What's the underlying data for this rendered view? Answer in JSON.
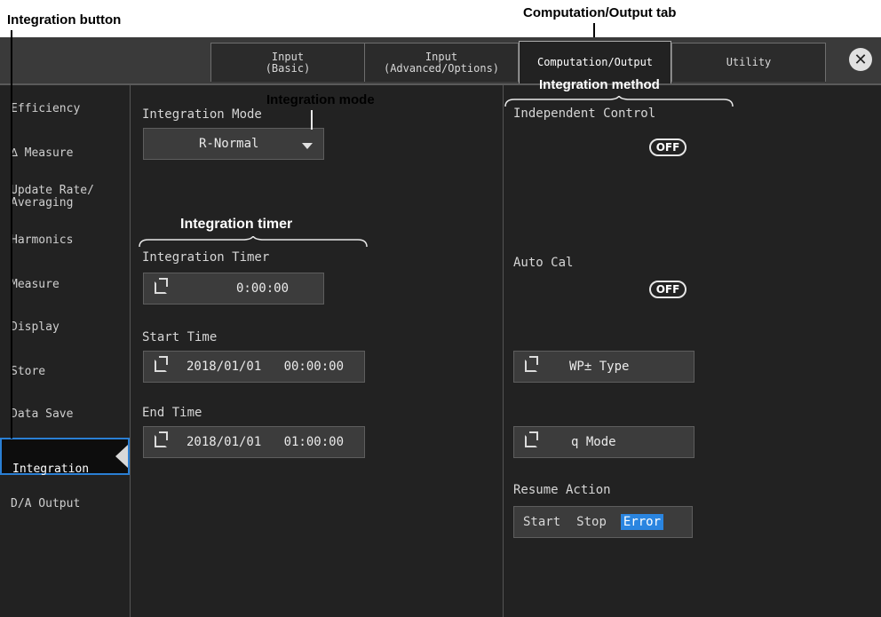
{
  "callouts": {
    "integration_button": "Integration button",
    "comp_output_tab": "Computation/Output tab",
    "integration_mode": "Integration mode",
    "integration_method": "Integration method",
    "integration_timer": "Integration timer"
  },
  "tabs": [
    {
      "label": "Input\n(Basic)"
    },
    {
      "label": "Input\n(Advanced/Options)"
    },
    {
      "label": "Computation/Output"
    },
    {
      "label": "Utility"
    }
  ],
  "close_glyph": "✕",
  "sidebar": {
    "items": [
      {
        "label": "Efficiency"
      },
      {
        "label": "∆ Measure"
      },
      {
        "label": "Update Rate/\nAveraging"
      },
      {
        "label": "Harmonics"
      },
      {
        "label": "Measure"
      },
      {
        "label": "Display"
      },
      {
        "label": "Store"
      },
      {
        "label": "Data Save"
      },
      {
        "label": "Integration"
      },
      {
        "label": "D/A Output"
      }
    ]
  },
  "main": {
    "integration_mode_label": "Integration Mode",
    "integration_mode_value": "R-Normal",
    "integration_timer_label": "Integration Timer",
    "integration_timer_value": "0:00:00",
    "start_time_label": "Start Time",
    "start_time_value": "2018/01/01   00:00:00",
    "end_time_label": "End Time",
    "end_time_value": "2018/01/01   01:00:00"
  },
  "right": {
    "independent_control_label": "Independent Control",
    "independent_control_value": "OFF",
    "auto_cal_label": "Auto Cal",
    "auto_cal_value": "OFF",
    "wp_type_label": "WP± Type",
    "q_mode_label": "q Mode",
    "resume_action_label": "Resume Action",
    "resume_options": [
      "Start",
      "Stop",
      "Error"
    ],
    "resume_selected": "Error"
  },
  "colors": {
    "accent": "#2a85e0",
    "background": "#222222"
  }
}
